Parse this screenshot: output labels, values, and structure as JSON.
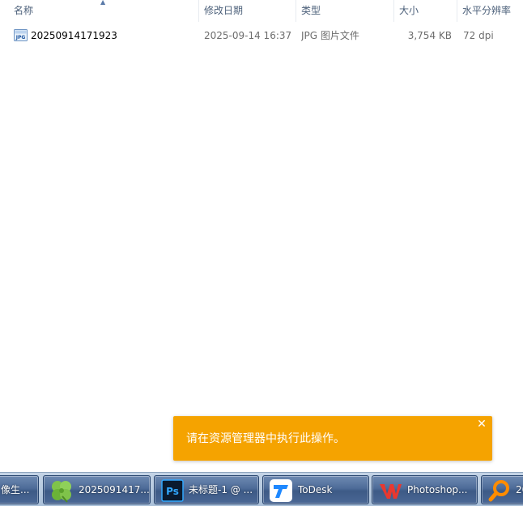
{
  "columns": {
    "name": "名称",
    "modified": "修改日期",
    "type": "类型",
    "size": "大小",
    "dpi": "水平分辨率"
  },
  "files": [
    {
      "icon": "jpg-file-icon",
      "name": "20250914171923",
      "modified": "2025-09-14 16:37",
      "type": "JPG 图片文件",
      "size": "3,754 KB",
      "dpi": "72 dpi"
    }
  ],
  "toast": {
    "message": "请在资源管理器中执行此操作。",
    "close_glyph": "✕",
    "color": "#f5a300"
  },
  "taskbar": {
    "items": [
      {
        "label": "像生...",
        "icon": "none"
      },
      {
        "label": "2025091417...",
        "icon": "clover-icon"
      },
      {
        "label": "未标题-1 @ ...",
        "icon": "photoshop-icon"
      },
      {
        "label": "ToDesk",
        "icon": "todesk-icon"
      },
      {
        "label": "Photoshop...",
        "icon": "wps-icon"
      },
      {
        "label": "20",
        "icon": "magnifier-icon"
      }
    ]
  },
  "icons": {
    "photoshop_text": "Ps",
    "jpg_text": "JPG"
  }
}
